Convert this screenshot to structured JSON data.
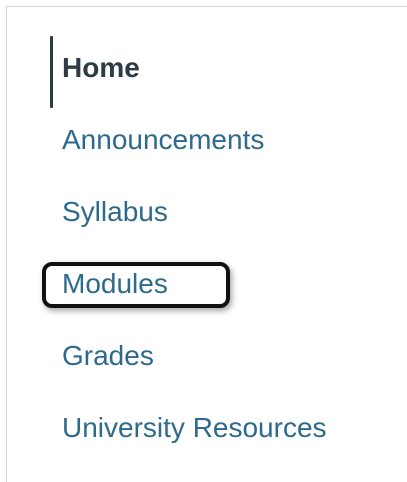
{
  "course_nav": {
    "items": [
      {
        "label": "Home",
        "active": true
      },
      {
        "label": "Announcements",
        "active": false
      },
      {
        "label": "Syllabus",
        "active": false
      },
      {
        "label": "Modules",
        "active": false,
        "highlighted": true
      },
      {
        "label": "Grades",
        "active": false
      },
      {
        "label": "University Resources",
        "active": false
      }
    ]
  },
  "colors": {
    "link": "#2d6a8c",
    "active_text": "#2d3b45",
    "highlight_border": "#111111"
  }
}
